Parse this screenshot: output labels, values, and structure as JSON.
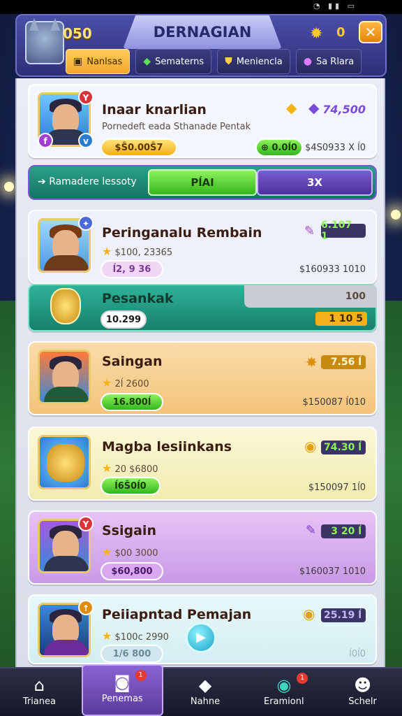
{
  "header": {
    "coins": "050",
    "title": "DERNAGIAN",
    "gear_count": "0",
    "close_label": "✕",
    "tabs": [
      {
        "label": "Nanlsas",
        "icon": "crate-icon"
      },
      {
        "label": "Sematerns",
        "icon": "leaf-icon"
      },
      {
        "label": "Meniencla",
        "icon": "shield-icon"
      },
      {
        "label": "Sa Rlara",
        "icon": "orb-icon"
      }
    ]
  },
  "cards": [
    {
      "name": "Inaar knarlian",
      "sub": "Pornedeft eada Sthanade Pentak",
      "pill": "$Ŝ0.00Ŝ7",
      "green": "⊕ 0.0ĺ0",
      "tag_value": "74,500",
      "price": "$4S0933 X ĺ0",
      "bg": "#f3f6ff"
    },
    {
      "name": "Peringanalu Rembain",
      "sub": "$100, 23365",
      "pill": "ĺ2, 9 36",
      "tag_value": "6.107 1",
      "price": "$160933 1010",
      "bg": "#eef1fb"
    },
    {
      "name": "Pesankak",
      "pill": "10.299",
      "right_top": "100",
      "tag_value": "1 10 5",
      "bg": "#2a9e86"
    },
    {
      "name": "Saingan",
      "sub": "2ĺ 2600",
      "pill": "16.800ĺ",
      "tag_value": "7.56 ĺ",
      "price": "$150087 ĺ010",
      "bg": "#f6d39b"
    },
    {
      "name": "Magba lesiinkans",
      "sub": "20 $6800",
      "pill": "ĺ6Ŝ0ĺ0",
      "tag_value": "74.30 ĺ",
      "price": "$150097 1ĺ0",
      "bg": "#f6f2c8"
    },
    {
      "name": "Ssigain",
      "sub": "$00 3000",
      "pill": "$60,800",
      "tag_value": "3 20 ĺ",
      "price": "$160037 1010",
      "bg": "#dcb5f0"
    },
    {
      "name": "Peiiapntad Pemajan",
      "sub": "$100c 2990",
      "pill": "1/6 800",
      "tag_value": "25.19 ĺ",
      "price": "ĺ0ĺ0",
      "bg": "#dcf3f6"
    }
  ],
  "progress": {
    "label": "Ramadere lessoty",
    "left": "PĺAI",
    "right": "3X"
  },
  "nav": [
    {
      "label": "Trianea",
      "icon": "house-icon"
    },
    {
      "label": "Penemas",
      "icon": "camera-icon",
      "badge": "1"
    },
    {
      "label": "Nahne",
      "icon": "diamond-icon"
    },
    {
      "label": "Eramionl",
      "icon": "portrait-icon",
      "badge": "1"
    },
    {
      "label": "Schelr",
      "icon": "user-icon"
    }
  ],
  "colors": {
    "accent": "#f3a52a",
    "header": "#2e2f78",
    "green": "#34b61d",
    "purple": "#4e2f9e"
  }
}
